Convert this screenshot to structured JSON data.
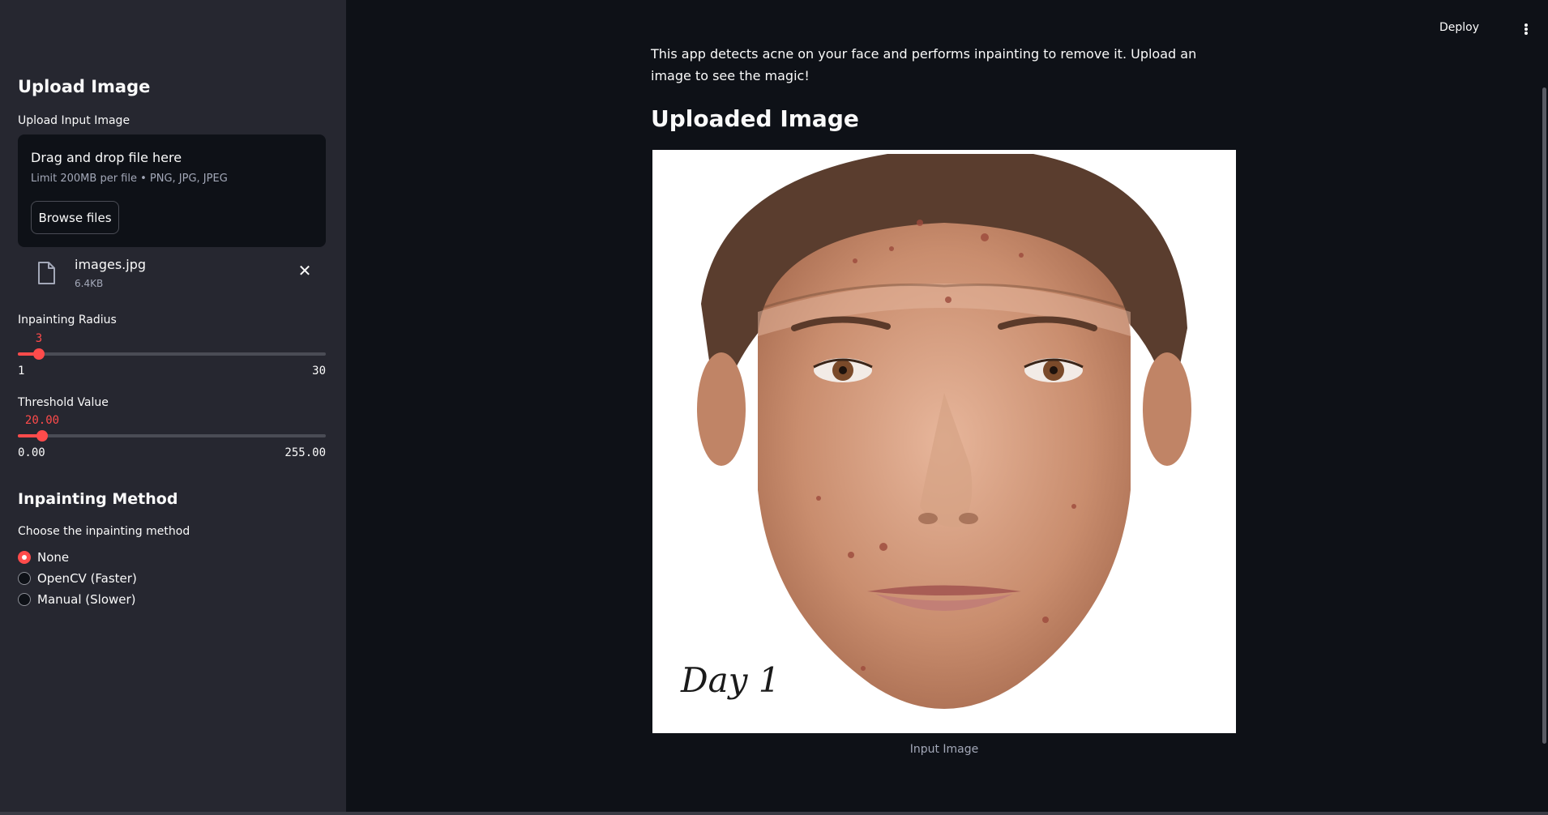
{
  "sidebar": {
    "upload_heading": "Upload Image",
    "upload_label": "Upload Input Image",
    "dropzone": {
      "title": "Drag and drop file here",
      "limit": "Limit 200MB per file • PNG, JPG, JPEG",
      "browse_label": "Browse files"
    },
    "file": {
      "name": "images.jpg",
      "size": "6.4KB"
    },
    "radius_slider": {
      "label": "Inpainting Radius",
      "value": "3",
      "min": "1",
      "max": "30",
      "fraction": 0.069
    },
    "threshold_slider": {
      "label": "Threshold Value",
      "value": "20.00",
      "min": "0.00",
      "max": "255.00",
      "fraction": 0.078
    },
    "method_heading": "Inpainting Method",
    "method_label": "Choose the inpainting method",
    "methods": [
      {
        "label": "None",
        "selected": true
      },
      {
        "label": "OpenCV (Faster)",
        "selected": false
      },
      {
        "label": "Manual (Slower)",
        "selected": false
      }
    ]
  },
  "header": {
    "deploy_label": "Deploy",
    "menu_icon": "kebab-menu-icon"
  },
  "main": {
    "description": "This app detects acne on your face and performs inpainting to remove it. Upload an image to see the magic!",
    "uploaded_heading": "Uploaded Image",
    "image_overlay_text": "Day 1",
    "image_caption": "Input Image"
  },
  "colors": {
    "accent": "#ff4b4b",
    "sidebar_bg": "#262730",
    "main_bg": "#0e1117"
  }
}
